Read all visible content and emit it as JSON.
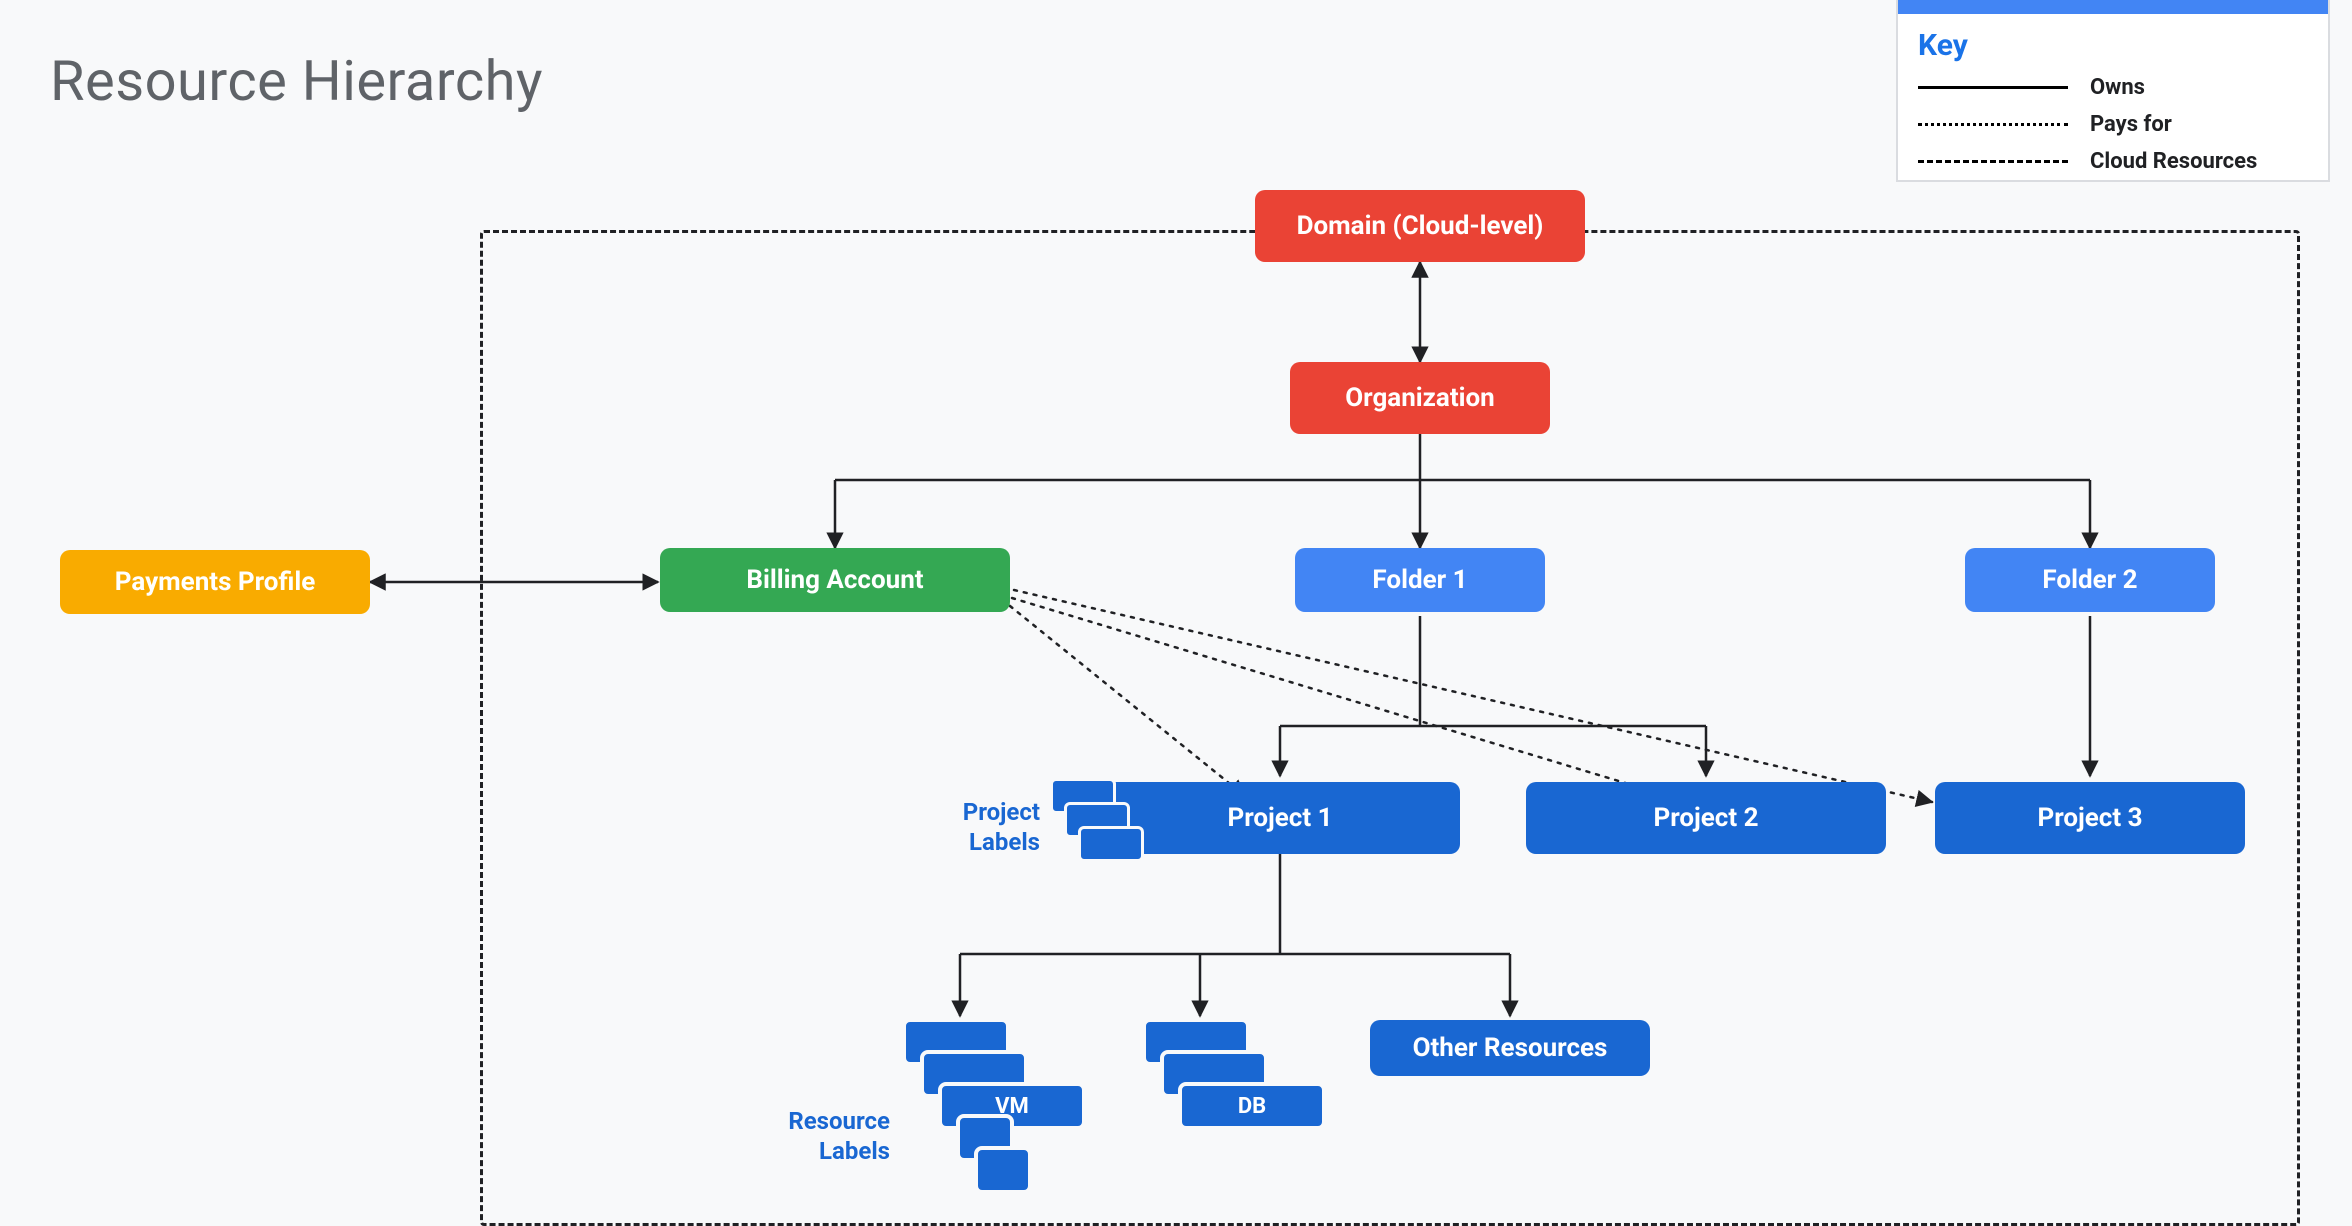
{
  "title": "Resource Hierarchy",
  "legend": {
    "heading": "Key",
    "items": [
      {
        "style": "solid",
        "label": "Owns"
      },
      {
        "style": "dotted",
        "label": "Pays for"
      },
      {
        "style": "dashed",
        "label": "Cloud Resources"
      }
    ]
  },
  "nodes": {
    "domain": "Domain (Cloud-level)",
    "organization": "Organization",
    "paymentsProfile": "Payments Profile",
    "billingAccount": "Billing Account",
    "folder1": "Folder 1",
    "folder2": "Folder 2",
    "project1": "Project 1",
    "project2": "Project 2",
    "project3": "Project 3",
    "vm": "VM",
    "db": "DB",
    "otherResources": "Other Resources"
  },
  "captions": {
    "projectLabels": "Project Labels",
    "resourceLabels": "Resource Labels"
  }
}
